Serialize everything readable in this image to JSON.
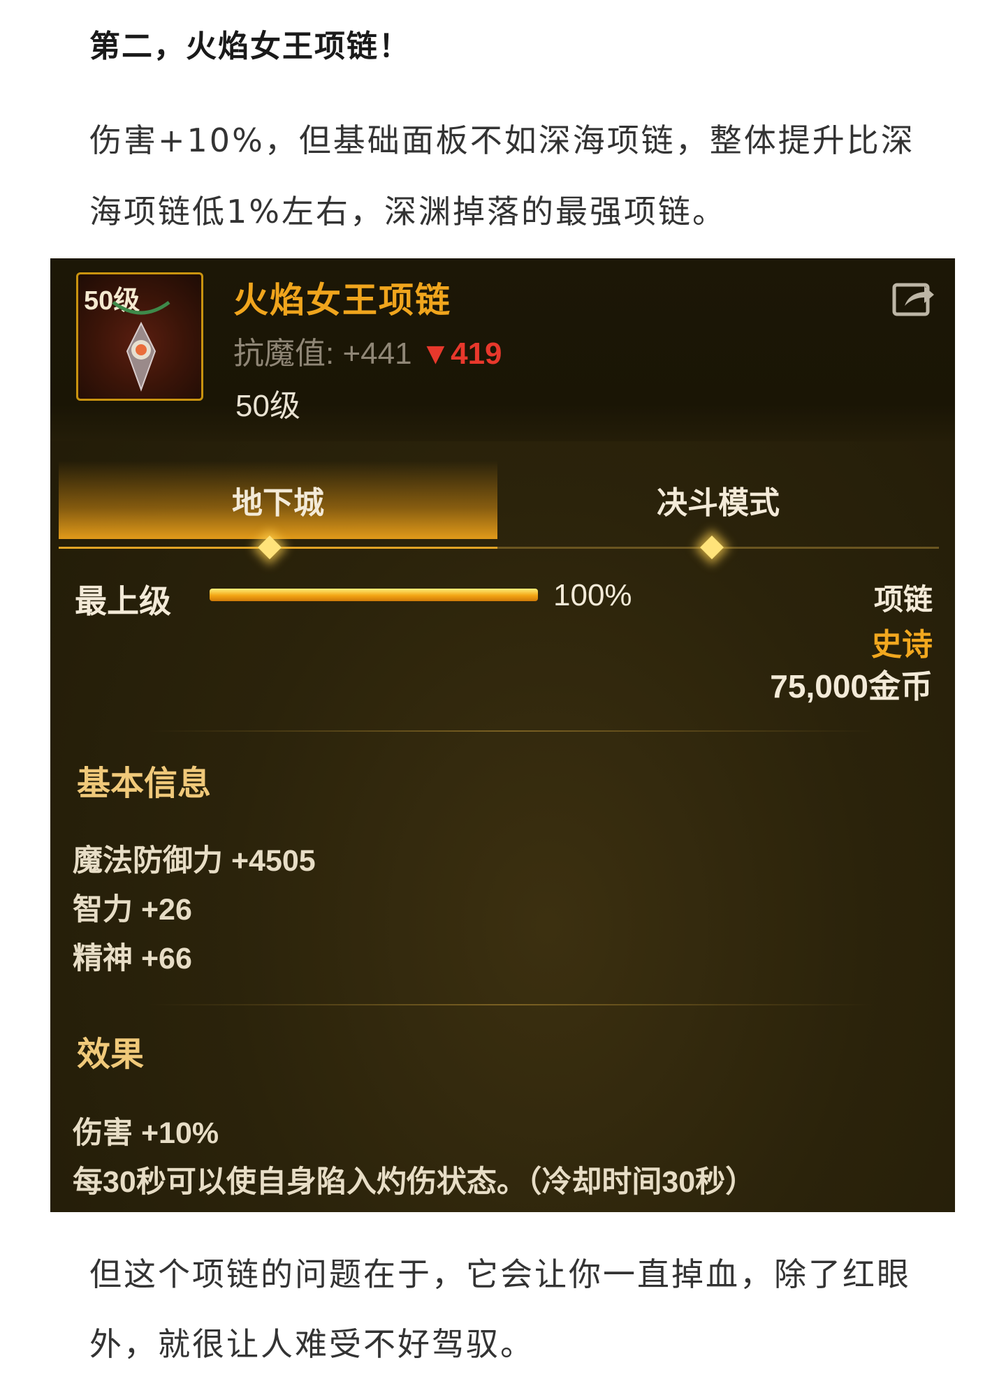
{
  "article": {
    "heading": "第二，火焰女王项链！",
    "para1": "伤害+10%，但基础面板不如深海项链，整体提升比深海项链低1%左右，深渊掉落的最强项链。",
    "para2": "但这个项链的问题在于，它会让你一直掉血，除了红眼外，就很让人难受不好驾驭。"
  },
  "item": {
    "icon_level": "50级",
    "name": "火焰女王项链",
    "stat_label": "抗魔值: +441",
    "stat_change": "▼419",
    "level": "50级",
    "share_icon": "share-icon"
  },
  "tabs": [
    {
      "label": "地下城",
      "active": true
    },
    {
      "label": "决斗模式",
      "active": false
    }
  ],
  "grade": {
    "label": "最上级",
    "progress": 1.0,
    "progress_text": "100%"
  },
  "meta": {
    "type": "项链",
    "rarity": "史诗",
    "price": "75,000金币"
  },
  "basic_info": {
    "title": "基本信息",
    "lines": [
      "魔法防御力 +4505",
      "智力 +26",
      "精神 +66"
    ]
  },
  "effects": {
    "title": "效果",
    "lines": [
      "伤害 +10%",
      "每30秒可以使自身陷入灼伤状态。（冷却时间30秒）"
    ]
  },
  "colors": {
    "accent": "#f0a51d",
    "rarity": "#f2a81f",
    "down": "#e8382c"
  }
}
